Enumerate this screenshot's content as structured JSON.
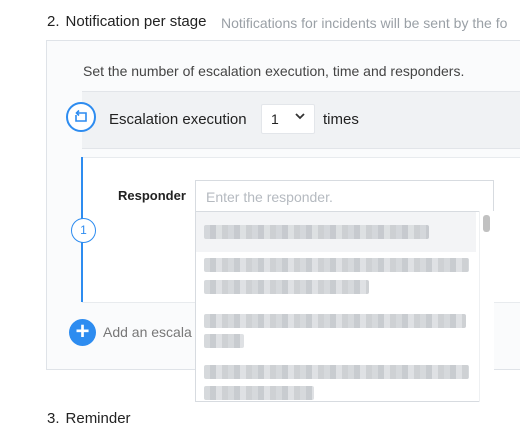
{
  "section2": {
    "number": "2.",
    "title": "Notification per stage",
    "description": "Notifications for incidents will be sent by the fo"
  },
  "panel": {
    "intro": "Set the number of escalation execution, time and responders."
  },
  "escalation": {
    "label": "Escalation execution",
    "select_value": "1",
    "suffix": "times"
  },
  "stage": {
    "number": "1",
    "responder_label": "Responder",
    "responder_placeholder": "Enter the responder.",
    "options_visible": 4
  },
  "add_escalation": {
    "label": "Add an escala"
  },
  "section3": {
    "number": "3.",
    "title": "Reminder"
  },
  "colors": {
    "accent": "#2d8cf0"
  }
}
